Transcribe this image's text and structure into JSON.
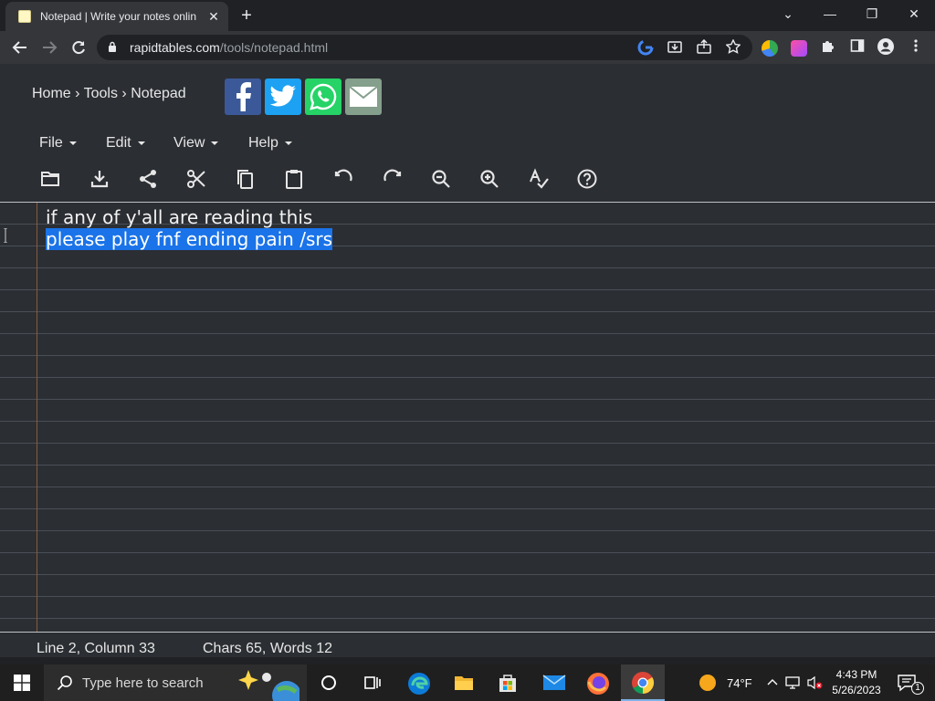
{
  "browser": {
    "tab_title": "Notepad | Write your notes onlin",
    "tab_close": "✕",
    "new_tab": "+",
    "url_host": "rapidtables.com",
    "url_path": "/tools/notepad.html",
    "window_controls": {
      "minimize": "—",
      "restore": "❐",
      "close": "✕",
      "tabsearch": "⌄"
    }
  },
  "page": {
    "breadcrumb": [
      {
        "label": "Home"
      },
      {
        "label": "Tools"
      },
      {
        "label": "Notepad"
      }
    ],
    "breadcrumb_sep": " › ",
    "social": [
      {
        "name": "facebook",
        "color": "#3b5998"
      },
      {
        "name": "twitter",
        "color": "#1da1f2"
      },
      {
        "name": "whatsapp",
        "color": "#25d366"
      },
      {
        "name": "email",
        "color": "#849f8b"
      }
    ],
    "menus": [
      {
        "label": "File"
      },
      {
        "label": "Edit"
      },
      {
        "label": "View"
      },
      {
        "label": "Help"
      }
    ],
    "toolbar_icons": [
      "folder-open-icon",
      "download-icon",
      "share-icon",
      "cut-icon",
      "copy-icon",
      "paste-icon",
      "undo-icon",
      "redo-icon",
      "zoom-out-icon",
      "zoom-in-icon",
      "spellcheck-icon",
      "help-icon"
    ]
  },
  "editor": {
    "lines": [
      {
        "text": "if any of y'all are reading this",
        "selected": false
      },
      {
        "text": "please play fnf ending pain /srs",
        "selected": true
      }
    ],
    "selection_color": "#1a73e8"
  },
  "status": {
    "position": "Line 2, Column 33",
    "counts": "Chars 65, Words 12"
  },
  "taskbar": {
    "search_placeholder": "Type here to search",
    "weather": "74°F",
    "time": "4:43 PM",
    "date": "5/26/2023",
    "notification_count": "1"
  }
}
